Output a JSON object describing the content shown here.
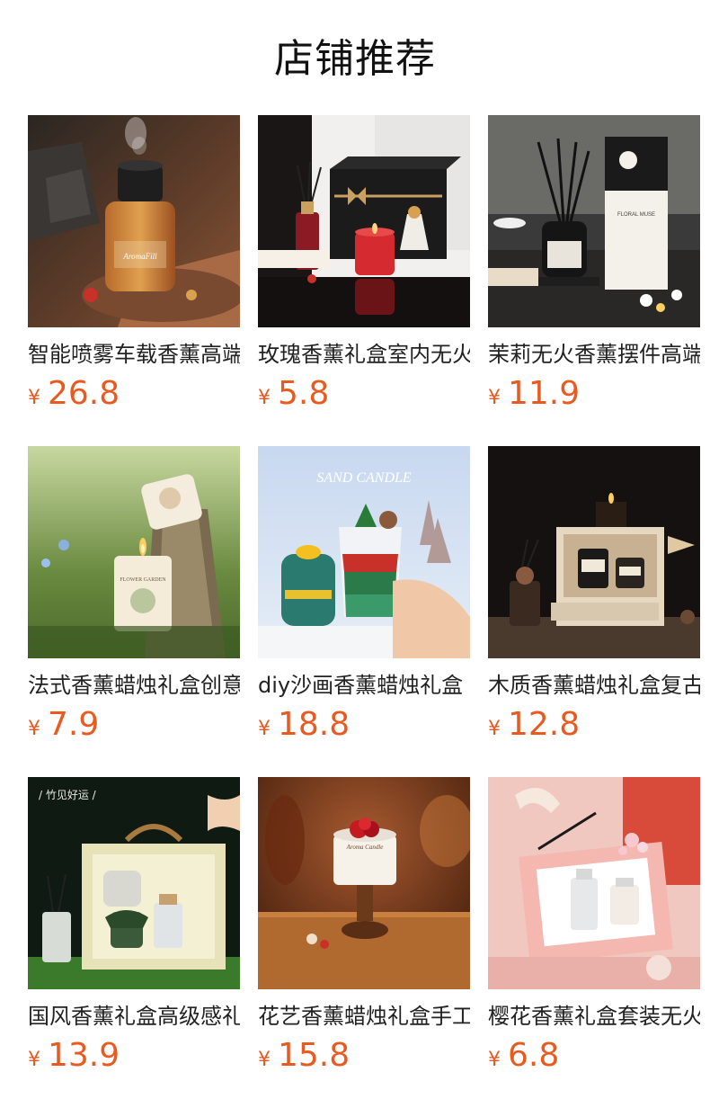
{
  "section_title": "店铺推荐",
  "currency_symbol": "¥",
  "price_color": "#e85a20",
  "products": [
    {
      "name": "智能喷雾车载香薰高端",
      "price": "26.8",
      "image": "car-aroma-diffuser-image"
    },
    {
      "name": "玫瑰香薰礼盒室内无火",
      "price": "5.8",
      "image": "rose-aroma-gift-box-image"
    },
    {
      "name": "茉莉无火香薰摆件高端",
      "price": "11.9",
      "image": "jasmine-reed-diffuser-image"
    },
    {
      "name": "法式香薰蜡烛礼盒创意",
      "price": "7.9",
      "image": "flower-garden-candle-image"
    },
    {
      "name": "diy沙画香薰蜡烛礼盒",
      "price": "18.8",
      "image": "sand-art-candle-image"
    },
    {
      "name": "木质香薰蜡烛礼盒复古",
      "price": "12.8",
      "image": "wooden-candle-gift-box-image"
    },
    {
      "name": "国风香薰礼盒高级感礼",
      "price": "13.9",
      "image": "chinese-style-gift-box-image"
    },
    {
      "name": "花艺香薰蜡烛礼盒手工",
      "price": "15.8",
      "image": "floral-candle-image"
    },
    {
      "name": "樱花香薰礼盒套装无火",
      "price": "6.8",
      "image": "sakura-gift-set-image"
    }
  ],
  "image_text": {
    "car_bottle_label": "AromaFill",
    "floral_muse": "FLORAL MUSE",
    "flower_garden": "FLOWER GARDEN",
    "sand_candle": "SAND CANDLE",
    "zhujian_haoyun": "/ 竹见好运 /",
    "aroma_candle": "Aroma Candle"
  }
}
